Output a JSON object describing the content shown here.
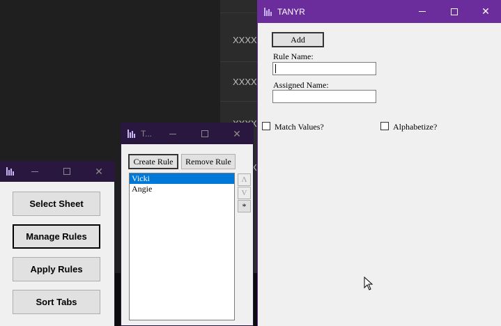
{
  "background": {
    "rows": [
      "XXXXXX",
      "XXXXXX",
      "XXXXXX",
      "XXXXXX"
    ]
  },
  "main_window": {
    "title": "TANYR",
    "add_button": "Add",
    "rule_name_label": "Rule Name:",
    "rule_name_value": "",
    "assigned_name_label": "Assigned Name:",
    "assigned_name_value": "",
    "match_values_label": "Match Values?",
    "alphabetize_label": "Alphabetize?",
    "match_values_checked": false,
    "alphabetize_checked": false,
    "titlebar_color": "#6b2c9c"
  },
  "rules_window": {
    "title": "T...",
    "create_rule_button": "Create Rule",
    "remove_rule_button": "Remove Rule",
    "rules": [
      "Vicki",
      "Angie"
    ],
    "selected_index": 0,
    "move_up_button": "Λ",
    "move_down_button": "V",
    "star_button": "*",
    "titlebar_color": "#2a1740"
  },
  "menu_window": {
    "buttons": [
      "Select Sheet",
      "Manage Rules",
      "Apply Rules",
      "Sort Tabs"
    ],
    "titlebar_color": "#2a1740"
  },
  "icons": {
    "app": "bar-chart-icon",
    "minimize": "minimize-icon",
    "maximize": "maximize-icon",
    "close": "close-icon",
    "cursor": "mouse-cursor-icon"
  },
  "colors": {
    "selection": "#0078d7",
    "window_bg": "#f0f0f0"
  }
}
